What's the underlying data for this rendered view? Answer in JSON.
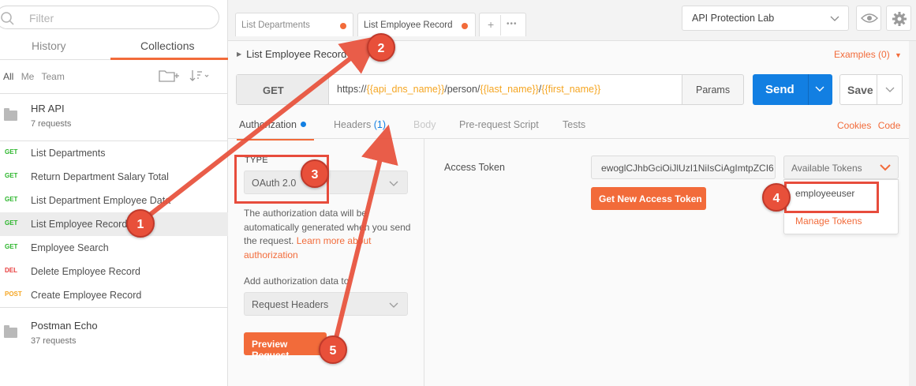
{
  "sidebar": {
    "filter_placeholder": "Filter",
    "tabs": {
      "history": "History",
      "collections": "Collections"
    },
    "filters": [
      "All",
      "Me",
      "Team"
    ],
    "collections": [
      {
        "name": "HR API",
        "count": "7 requests"
      },
      {
        "name": "Postman Echo",
        "count": "37 requests"
      }
    ],
    "requests": [
      {
        "method": "GET",
        "name": "List Departments"
      },
      {
        "method": "GET",
        "name": "Return Department Salary Total"
      },
      {
        "method": "GET",
        "name": "List Department Employee Data"
      },
      {
        "method": "GET",
        "name": "List Employee Record",
        "selected": true
      },
      {
        "method": "GET",
        "name": "Employee Search"
      },
      {
        "method": "DEL",
        "name": "Delete Employee Record"
      },
      {
        "method": "POST",
        "name": "Create Employee Record"
      }
    ]
  },
  "tabs": [
    {
      "label": "List Departments",
      "unsaved": true
    },
    {
      "label": "List Employee Record",
      "unsaved": true,
      "active": true
    }
  ],
  "tab_actions": {
    "add": "+",
    "more": "•••"
  },
  "environment": "API Protection Lab",
  "request": {
    "title": "List Employee Record",
    "examples": "Examples (0)",
    "method": "GET",
    "url_prefix": "https://",
    "url_var1": "{{api_dns_name}}",
    "url_mid": "/person/",
    "url_var2": "{{last_name}}",
    "url_sep": "/",
    "url_var3": "{{first_name}}",
    "params": "Params",
    "send": "Send",
    "save": "Save"
  },
  "subtabs": {
    "authorization": "Authorization",
    "headers": "Headers",
    "headers_count": "(1)",
    "body": "Body",
    "prerequest": "Pre-request Script",
    "tests": "Tests",
    "cookies": "Cookies",
    "code": "Code"
  },
  "auth": {
    "type_label": "TYPE",
    "type_value": "OAuth 2.0",
    "desc": "The authorization data will be automatically generated when you send the request. ",
    "learn_more": "Learn more about authorization",
    "add_label": "Add authorization data to",
    "add_value": "Request Headers",
    "preview": "Preview Request",
    "access_token_label": "Access Token",
    "token_value": "ewoglCJhbGciOiJlUzI1NiIsCiAgImtpZCI6",
    "available_tokens": "Available Tokens",
    "get_new": "Get New Access Token",
    "token_options": [
      "employeeuser"
    ],
    "manage_tokens": "Manage Tokens"
  },
  "annotations": [
    "1",
    "2",
    "3",
    "4",
    "5"
  ],
  "colors": {
    "accent": "#f26b3a",
    "primary": "#127fe2",
    "get": "#2ab52a",
    "del": "#e83c3c",
    "post": "#f5a623",
    "annotation": "#e8503a"
  }
}
